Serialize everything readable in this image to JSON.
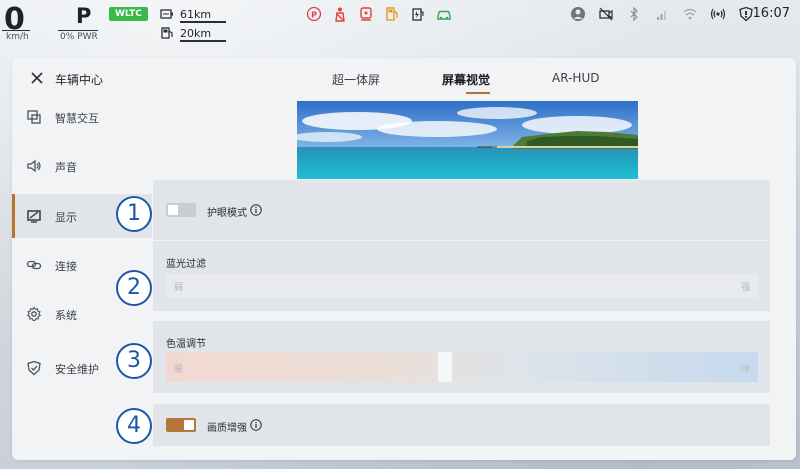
{
  "status": {
    "speed": "0",
    "speed_unit": "km/h",
    "gear": "P",
    "power": "0% PWR",
    "cycle_badge": "WLTC",
    "range_electric": "61km",
    "range_fuel": "20km",
    "time": "16:07",
    "warning_icons": [
      "parking-brake-icon",
      "seatbelt-icon",
      "seat-heat-icon",
      "fuel-warning-icon",
      "battery-charge-icon",
      "car-alert-icon"
    ],
    "system_icons": [
      "user-icon",
      "no-camera-icon",
      "bluetooth-icon",
      "signal-icon",
      "wifi-icon",
      "broadcast-icon",
      "shield-icon"
    ]
  },
  "panel": {
    "title": "车辆中心"
  },
  "sidebar": {
    "items": [
      {
        "label": "智慧交互",
        "icon": "smart-interaction-icon",
        "active": false
      },
      {
        "label": "声音",
        "icon": "speaker-icon",
        "active": false
      },
      {
        "label": "显示",
        "icon": "display-icon",
        "active": true
      },
      {
        "label": "连接",
        "icon": "link-icon",
        "active": false
      },
      {
        "label": "系统",
        "icon": "gear-icon",
        "active": false
      },
      {
        "label": "安全维护",
        "icon": "shield-check-icon",
        "active": false
      }
    ]
  },
  "tabs": [
    {
      "label": "超一体屏",
      "active": false
    },
    {
      "label": "屏幕视觉",
      "active": true
    },
    {
      "label": "AR-HUD",
      "active": false
    }
  ],
  "settings": {
    "eye_care": {
      "label": "护眼模式",
      "enabled": false
    },
    "blue_light": {
      "label": "蓝光过滤",
      "low": "弱",
      "high": "强"
    },
    "color_temp": {
      "label": "色温调节",
      "low": "暖",
      "high": "冷",
      "level": 0.47
    },
    "enhance": {
      "label": "画质增强",
      "enabled": true
    }
  },
  "badges": [
    "1",
    "2",
    "3",
    "4"
  ]
}
